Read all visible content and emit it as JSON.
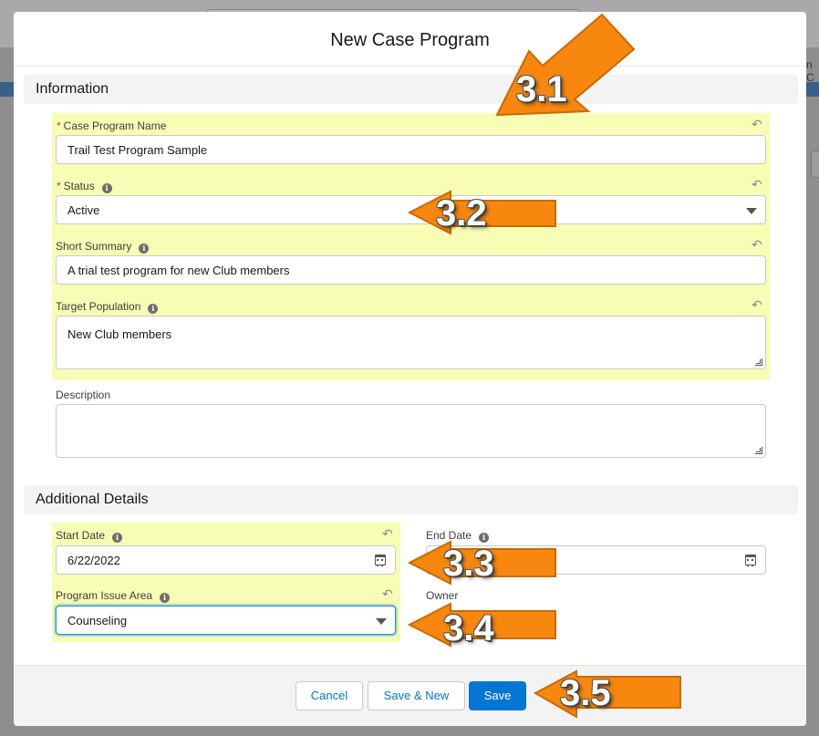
{
  "background": {
    "right_edge_text": "n C"
  },
  "modal": {
    "title": "New Case Program"
  },
  "sections": {
    "information": "Information",
    "additional_details": "Additional Details"
  },
  "fields": {
    "case_program_name": {
      "label": "Case Program Name",
      "value": "Trail Test Program Sample",
      "required": true
    },
    "status": {
      "label": "Status",
      "value": "Active",
      "required": true
    },
    "short_summary": {
      "label": "Short Summary",
      "value": "A trial test program for new Club members"
    },
    "target_population": {
      "label": "Target Population",
      "value": "New Club members"
    },
    "description": {
      "label": "Description",
      "value": ""
    },
    "start_date": {
      "label": "Start Date",
      "value": "6/22/2022"
    },
    "end_date": {
      "label": "End Date",
      "value": ""
    },
    "program_issue_area": {
      "label": "Program Issue Area",
      "value": "Counseling"
    },
    "owner": {
      "label": "Owner"
    }
  },
  "footer": {
    "cancel_label": "Cancel",
    "save_new_label": "Save & New",
    "save_label": "Save"
  },
  "annotations": {
    "a1": "3.1",
    "a2": "3.2",
    "a3": "3.3",
    "a4": "3.4",
    "a5": "3.5"
  },
  "colors": {
    "highlight": "#f7fdb4",
    "brand": "#0176d3",
    "arrow": "#f7870f",
    "required": "#c23934"
  },
  "icons": {
    "info": "info-icon",
    "undo": "undo-icon",
    "calendar": "calendar-icon",
    "dropdown": "chevron-down-icon"
  }
}
